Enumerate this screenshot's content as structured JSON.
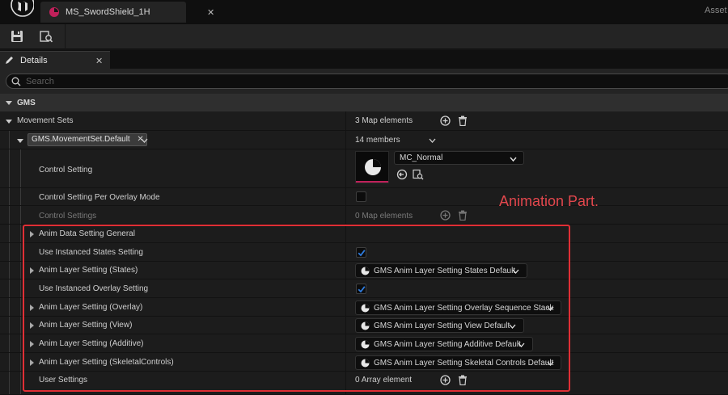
{
  "title_bar": {
    "tab_label": "MS_SwordShield_1H",
    "tab_close": "✕",
    "right_label": "Asset"
  },
  "details_panel": {
    "title": "Details",
    "close": "✕",
    "search_placeholder": "Search"
  },
  "category": {
    "label": "GMS"
  },
  "movement_sets": {
    "label": "Movement Sets",
    "value": "3 Map elements",
    "entry_key": "GMS.MovementSet.Default",
    "entry_key_clear": "✕",
    "entry_value": "14 members"
  },
  "properties": {
    "control_setting": {
      "label": "Control Setting",
      "asset": "MC_Normal"
    },
    "control_setting_per_overlay": {
      "label": "Control Setting Per Overlay Mode",
      "checked": false
    },
    "control_settings": {
      "label": "Control Settings",
      "value": "0 Map elements"
    },
    "anim_data_setting_general": {
      "label": "Anim Data Setting General"
    },
    "use_instanced_states": {
      "label": "Use Instanced States Setting",
      "checked": true
    },
    "anim_layer_states": {
      "label": "Anim Layer Setting (States)",
      "value": "GMS Anim Layer Setting States Default"
    },
    "use_instanced_overlay": {
      "label": "Use Instanced Overlay Setting",
      "checked": true
    },
    "anim_layer_overlay": {
      "label": "Anim Layer Setting (Overlay)",
      "value": "GMS Anim Layer Setting Overlay Sequence Stack"
    },
    "anim_layer_view": {
      "label": "Anim Layer Setting (View)",
      "value": "GMS Anim Layer Setting View Default"
    },
    "anim_layer_additive": {
      "label": "Anim Layer Setting (Additive)",
      "value": "GMS Anim Layer Setting Additive Default"
    },
    "anim_layer_skeletal": {
      "label": "Anim Layer Setting (SkeletalControls)",
      "value": "GMS Anim Layer Setting Skeletal Controls Default"
    },
    "user_settings": {
      "label": "User Settings",
      "value": "0 Array element"
    }
  },
  "annotation": {
    "text": "Animation Part."
  },
  "colors": {
    "accent_red": "#e02f35",
    "checkbox_blue": "#2f7de0",
    "asset_magenta": "#c0205a"
  },
  "icons": [
    "ue-logo-icon",
    "asset-tab-icon",
    "save-icon",
    "browse-icon",
    "pencil-icon",
    "search-icon",
    "plus-circle-icon",
    "trash-icon",
    "pie-icon",
    "chevron-down-icon",
    "arrow-right-icon",
    "arrow-down-icon",
    "use-selected-icon",
    "browse-asset-icon",
    "check-icon"
  ]
}
